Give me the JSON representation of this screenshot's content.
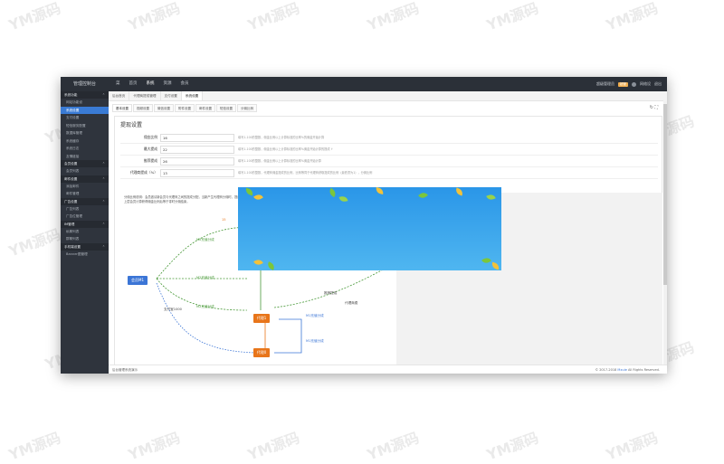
{
  "watermark": {
    "text": "YM源码",
    "color": "#d9d9d9"
  },
  "app": {
    "title": "管理控制台"
  },
  "topnav": {
    "items": [
      "菜",
      "首页",
      "系统",
      "资源",
      "会员"
    ],
    "active_index": 2,
    "user_label": "超级管理员",
    "badge": "超管",
    "right_a": "网络设",
    "right_b": "退出"
  },
  "sidebar": {
    "sections": [
      {
        "title": "系统功能",
        "items": [
          "网站功能设",
          "系统设置",
          "支付设置",
          "短信服务配置",
          "数据库管理",
          "系统缓存",
          "系统日志",
          "友情链接"
        ]
      },
      {
        "title": "会员设置",
        "items": [
          "会员列表"
        ]
      },
      {
        "title": "邮件设置",
        "items": [
          "添加邮件",
          "邮件管理"
        ]
      },
      {
        "title": "广告设置",
        "items": [
          "广告列表",
          "广告位管理"
        ]
      },
      {
        "title": "IM管理",
        "items": [
          "私聊列表",
          "群聊列表"
        ]
      },
      {
        "title": "手机端设置",
        "items": [
          "Banner图管理"
        ]
      }
    ],
    "active_item": "系统设置"
  },
  "tabs": {
    "items": [
      "后台首页",
      "代理商提成管理",
      "支付设置",
      "系统设置"
    ],
    "active_index": 3
  },
  "subtabs": {
    "items": [
      "基本设置",
      "视频设置",
      "微信设置",
      "附件设置",
      "邮件设置",
      "短信设置",
      "分佣比例"
    ],
    "active_index": 0
  },
  "section_title": "提现设置",
  "form_rows": [
    {
      "label": "佣金比例",
      "value": "16",
      "hint": "填写1-100的整数，佣金比例以上计算标准的比率%的佣金开始计算"
    },
    {
      "label": "最大提成",
      "value": "22",
      "hint": "填写1-100的整数，佣金比例以上计算标准的比率%佣金开始计算的提成 ↑"
    },
    {
      "label": "推荐提成",
      "value": "26",
      "hint": "填写1-100的整数，佣金比例以上计算标准的比率%佣金开始计算"
    },
    {
      "label": "代理商提成（%）",
      "value": "13",
      "hint": "填写1-100的整数，代理商佣金提成的比例，比例等同于代理商获取提成的比例（最低须为1），分佣比例"
    }
  ],
  "diagram": {
    "note": "分佣比例说明：会员邀请新会员与代理商之间的提成分配，当新产生代理商分佣时，提成以上层代理商根据设置比例计算分佣金额，会员邀请新会员同步产生分销收益，具体分配以上面设置比例为准，在上层会员计算获得佣金比例后等于零时分佣结束。",
    "nodes": {
      "member": "会员M1",
      "agent1": "代理1",
      "agent2": "代理0"
    },
    "labels": {
      "top_marker": "15",
      "m2a": "M2充值分成",
      "m2b": "M2充值分成",
      "m2c": "M2充值分成",
      "m1a": "M1充值分成",
      "m1b": "M1充值分成",
      "recommend": "推荐提成",
      "pay": "支付宝1000",
      "agent_pay": "代理商费"
    }
  },
  "footer": {
    "left": "后台管理系统演示",
    "right_prefix": "© 2017-2018",
    "right_link": "Mxuie",
    "right_suffix": "All Rights Reserved."
  },
  "colors": {
    "accent": "#3a7bd5",
    "topbar": "#2b3038",
    "sidebar": "#2f343d",
    "orange": "#e8751a",
    "green": "#4a9a3a"
  }
}
